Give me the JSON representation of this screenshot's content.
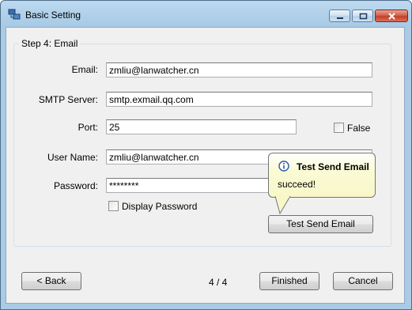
{
  "window": {
    "title": "Basic Setting",
    "icon": "network-setup-icon"
  },
  "step": {
    "group_title": "Step 4: Email"
  },
  "form": {
    "email_label": "Email:",
    "email_value": "zmliu@lanwatcher.cn",
    "smtp_label": "SMTP Server:",
    "smtp_value": "smtp.exmail.qq.com",
    "port_label": "Port:",
    "port_value": "25",
    "ssl_checkbox_label": "False",
    "ssl_checked": false,
    "username_label": "User Name:",
    "username_value": "zmliu@lanwatcher.cn",
    "password_label": "Password:",
    "password_value": "********",
    "display_password_label": "Display Password",
    "display_password_checked": false,
    "test_button": "Test Send Email"
  },
  "balloon": {
    "title": "Test Send Email",
    "message": "succeed!",
    "icon": "info-icon"
  },
  "footer": {
    "back": "< Back",
    "page": "4 / 4",
    "finished": "Finished",
    "cancel": "Cancel"
  },
  "colors": {
    "titlebar": "#a9cbe6",
    "close_button": "#c23f27",
    "balloon_bg": "#f7f7c9",
    "dialog_bg": "#f0f0f0"
  }
}
